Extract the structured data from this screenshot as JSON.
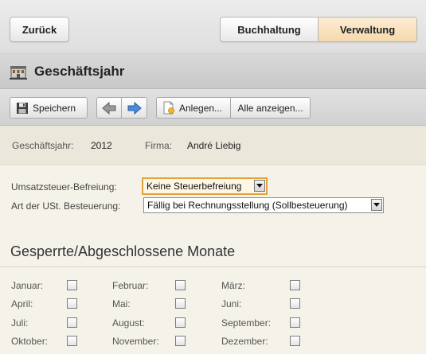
{
  "nav": {
    "back_label": "Zurück",
    "tabs": [
      {
        "label": "Buchhaltung",
        "active": false
      },
      {
        "label": "Verwaltung",
        "active": true
      }
    ]
  },
  "header": {
    "title": "Geschäftsjahr",
    "icon": "building-icon"
  },
  "toolbar": {
    "save_label": "Speichern",
    "prev_icon": "arrow-left-icon",
    "next_icon": "arrow-right-icon",
    "new_label": "Anlegen...",
    "all_label": "Alle anzeigen..."
  },
  "info": {
    "year_label": "Geschäftsjahr:",
    "year_value": "2012",
    "company_label": "Firma:",
    "company_value": "André Liebig"
  },
  "form": {
    "vat_exemption_label": "Umsatzsteuer-Befreiung:",
    "vat_exemption_value": "Keine Steuerbefreiung",
    "vat_type_label": "Art der USt. Besteuerung:",
    "vat_type_value": "Fällig bei Rechnungsstellung (Sollbesteuerung)"
  },
  "months_section": {
    "title": "Gesperrte/Abgeschlossene Monate",
    "months": [
      {
        "label": "Januar:",
        "checked": false
      },
      {
        "label": "Februar:",
        "checked": false
      },
      {
        "label": "März:",
        "checked": false
      },
      {
        "label": "April:",
        "checked": false
      },
      {
        "label": "Mai:",
        "checked": false
      },
      {
        "label": "Juni:",
        "checked": false
      },
      {
        "label": "Juli:",
        "checked": false
      },
      {
        "label": "August:",
        "checked": false
      },
      {
        "label": "September:",
        "checked": false
      },
      {
        "label": "Oktober:",
        "checked": false
      },
      {
        "label": "November:",
        "checked": false
      },
      {
        "label": "Dezember:",
        "checked": false
      }
    ]
  },
  "colors": {
    "accent_active_tab": "#f6d9ad",
    "focus_border": "#e2a33a",
    "info_background": "#ebe7db",
    "form_background": "#f5f2e9"
  }
}
